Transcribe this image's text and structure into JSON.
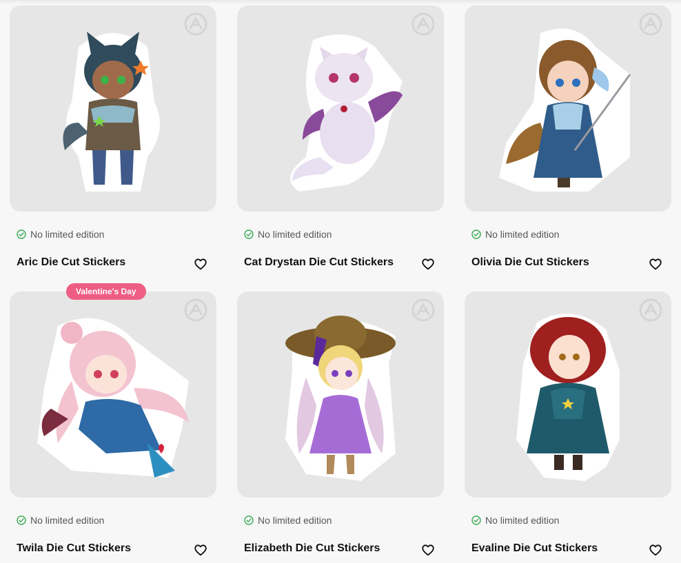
{
  "badges": {
    "valentines": "Valentine's Day"
  },
  "colors": {
    "badge": "#ee5d83",
    "status_check": "#3aaa55",
    "card_bg": "#e6e6e6"
  },
  "products": [
    {
      "title": "Aric Die Cut Stickers",
      "status": "No limited edition",
      "art": "catboy-character-sticker"
    },
    {
      "title": "Cat Drystan Die Cut Stickers",
      "status": "No limited edition",
      "art": "winged-cat-sticker"
    },
    {
      "title": "Olivia Die Cut Stickers",
      "status": "No limited edition",
      "art": "swordswoman-sticker"
    },
    {
      "title": "Twila Die Cut Stickers",
      "status": "No limited edition",
      "art": "pink-haired-demon-girl-sticker"
    },
    {
      "title": "Elizabeth Die Cut Stickers",
      "status": "No limited edition",
      "art": "purple-dress-girl-sticker"
    },
    {
      "title": "Evaline Die Cut Stickers",
      "status": "No limited edition",
      "art": "red-haired-girl-sticker"
    }
  ]
}
